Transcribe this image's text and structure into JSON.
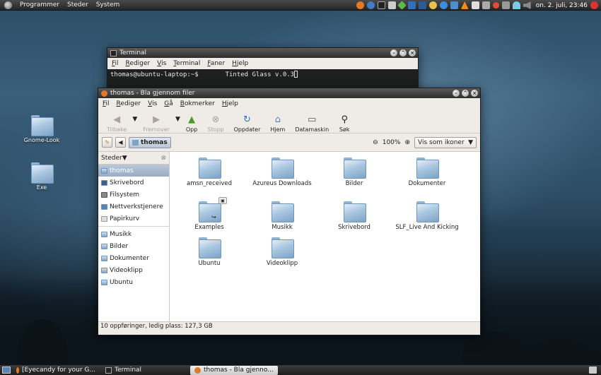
{
  "top_panel": {
    "menus": [
      "Programmer",
      "Steder",
      "System"
    ],
    "clock": "on. 2. juli, 23:46"
  },
  "desktop_icons": [
    {
      "label": "Gnome-Look"
    },
    {
      "label": "Exe"
    }
  ],
  "terminal": {
    "title": "Terminal",
    "menu": [
      "Fil",
      "Rediger",
      "Vis",
      "Terminal",
      "Faner",
      "Hjelp"
    ],
    "prompt": "thomas@ubuntu-laptop:~$",
    "output": "Tinted Glass v.0.3"
  },
  "nautilus": {
    "title": "thomas - Bla gjennom filer",
    "menu": [
      "Fil",
      "Rediger",
      "Vis",
      "Gå",
      "Bokmerker",
      "Hjelp"
    ],
    "toolbar": {
      "back": "Tilbake",
      "forward": "Fremover",
      "up": "Opp",
      "stop": "Stopp",
      "reload": "Oppdater",
      "home": "Hjem",
      "computer": "Datamaskin",
      "search": "Søk"
    },
    "location": {
      "crumb": "thomas",
      "zoom": "100%",
      "view_mode": "Vis som ikoner"
    },
    "sidebar": {
      "header": "Steder",
      "places": [
        "thomas",
        "Skrivebord",
        "Filsystem",
        "Nettverkstjenere",
        "Papirkurv"
      ],
      "bookmarks": [
        "Musikk",
        "Bilder",
        "Dokumenter",
        "Videoklipp",
        "Ubuntu"
      ]
    },
    "files": [
      "amsn_received",
      "Azureus Downloads",
      "Bilder",
      "Dokumenter",
      "Examples",
      "Musikk",
      "Skrivebord",
      "SLF_Live And Kicking",
      "Ubuntu",
      "Videoklipp"
    ],
    "status": "10 oppføringer, ledig plass: 127,3 GB"
  },
  "taskbar": {
    "tasks": [
      "[Eyecandy for your G...",
      "Terminal",
      "thomas - Bla gjenno..."
    ]
  }
}
